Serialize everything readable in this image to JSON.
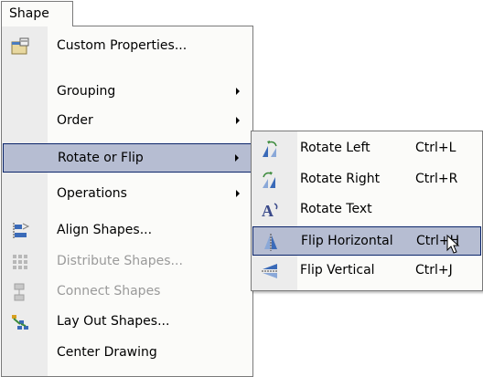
{
  "menubar": {
    "shape_label": "Shape"
  },
  "main_menu": {
    "items": [
      {
        "label": "Custom Properties...",
        "icon": "custom-properties-icon"
      },
      {
        "label": "Grouping",
        "submenu": true
      },
      {
        "label": "Order",
        "submenu": true
      },
      {
        "label": "Rotate or Flip",
        "submenu": true,
        "highlighted": true
      },
      {
        "label": "Operations",
        "submenu": true
      },
      {
        "label": "Align Shapes...",
        "icon": "align-shapes-icon"
      },
      {
        "label": "Distribute Shapes...",
        "icon": "distribute-shapes-icon",
        "disabled": true
      },
      {
        "label": "Connect Shapes",
        "icon": "connect-shapes-icon",
        "disabled": true
      },
      {
        "label": "Lay Out Shapes...",
        "icon": "lay-out-shapes-icon"
      },
      {
        "label": "Center Drawing"
      }
    ]
  },
  "submenu": {
    "items": [
      {
        "label": "Rotate Left",
        "shortcut": "Ctrl+L",
        "icon": "rotate-left-icon"
      },
      {
        "label": "Rotate Right",
        "shortcut": "Ctrl+R",
        "icon": "rotate-right-icon"
      },
      {
        "label": "Rotate Text",
        "shortcut": "",
        "icon": "rotate-text-icon"
      },
      {
        "label": "Flip Horizontal",
        "shortcut": "Ctrl+H",
        "icon": "flip-horizontal-icon",
        "highlighted": true
      },
      {
        "label": "Flip Vertical",
        "shortcut": "Ctrl+J",
        "icon": "flip-vertical-icon"
      }
    ]
  },
  "colors": {
    "highlight_bg": "#b6bdd2",
    "highlight_border": "#0a246a",
    "icon_strip": "#ececec",
    "disabled_text": "#9a9a9a"
  }
}
